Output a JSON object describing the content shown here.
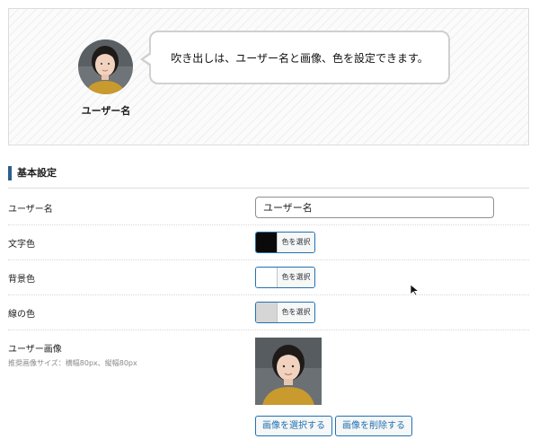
{
  "preview": {
    "avatar_name": "ユーザー名",
    "bubble_text": "吹き出しは、ユーザー名と画像、色を設定できます。"
  },
  "section": {
    "title": "基本設定"
  },
  "fields": {
    "user_name": {
      "label": "ユーザー名",
      "value": "ユーザー名"
    },
    "text_color": {
      "label": "文字色",
      "swatch": "#0a0a0a",
      "button": "色を選択"
    },
    "bg_color": {
      "label": "背景色",
      "swatch": "#ffffff",
      "button": "色を選択"
    },
    "line_color": {
      "label": "線の色",
      "swatch": "#d6d6d6",
      "button": "色を選択"
    },
    "user_image": {
      "label": "ユーザー画像",
      "hint": "推奨画像サイズ：横幅80px、縦幅80px",
      "select_button": "画像を選択する",
      "remove_button": "画像を削除する"
    }
  },
  "colors": {
    "accent": "#2271b1",
    "section_marker": "#2c5f8a"
  }
}
